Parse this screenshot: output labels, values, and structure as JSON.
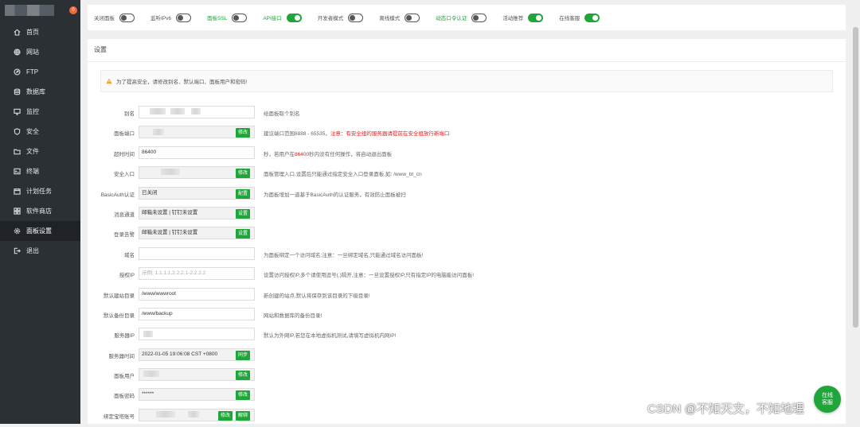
{
  "brand": {
    "badge": "0"
  },
  "sidebar": {
    "items": [
      {
        "label": "首页",
        "icon": "home-icon"
      },
      {
        "label": "网站",
        "icon": "globe-icon"
      },
      {
        "label": "FTP",
        "icon": "ftp-icon"
      },
      {
        "label": "数据库",
        "icon": "database-icon"
      },
      {
        "label": "监控",
        "icon": "monitor-icon"
      },
      {
        "label": "安全",
        "icon": "shield-icon"
      },
      {
        "label": "文件",
        "icon": "folder-icon"
      },
      {
        "label": "终端",
        "icon": "terminal-icon"
      },
      {
        "label": "计划任务",
        "icon": "calendar-icon"
      },
      {
        "label": "软件商店",
        "icon": "store-icon"
      },
      {
        "label": "面板设置",
        "icon": "gear-icon",
        "active": true
      },
      {
        "label": "退出",
        "icon": "logout-icon"
      }
    ]
  },
  "switches": [
    {
      "label": "关闭面板",
      "on": false,
      "green": false
    },
    {
      "label": "监听IPv6",
      "on": false,
      "green": false
    },
    {
      "label": "面板SSL",
      "on": false,
      "green": true
    },
    {
      "label": "API接口",
      "on": true,
      "green": true
    },
    {
      "label": "开发者模式",
      "on": false,
      "green": false
    },
    {
      "label": "离线模式",
      "on": false,
      "green": false
    },
    {
      "label": "动态口令认证",
      "on": false,
      "green": true
    },
    {
      "label": "活动推荐",
      "on": true,
      "green": false
    },
    {
      "label": "在线客服",
      "on": true,
      "green": false
    }
  ],
  "panel": {
    "title": "设置",
    "warning": "为了提高安全，请修改别名、默认端口、面板用户和密码!"
  },
  "settings": {
    "alias": {
      "label": "别名",
      "desc": "给面板取个别名"
    },
    "port": {
      "label": "面板端口",
      "button": "修改",
      "desc_prefix": "建议端口范围8888 - 65535，",
      "desc_warn": "注意：有安全组的服务器请提前在安全组放行新端口"
    },
    "timeout": {
      "label": "超时时间",
      "value": "86400",
      "desc_prefix": "秒，若用户在",
      "desc_value": "86400",
      "desc_suffix": "秒内没有任何操作，将自动退出面板"
    },
    "entry": {
      "label": "安全入口",
      "button": "修改",
      "desc": "面板管理入口,设置后只能通过指定安全入口登录面板,如: /www_bt_cn"
    },
    "basicauth": {
      "label": "BasicAuth认证",
      "value": "已关闭",
      "button": "配置",
      "desc": "为面板增加一道基于BasicAuth的认证服务，有效防止面板被扫"
    },
    "notify": {
      "label": "消息通道",
      "value": "邮箱未设置 | 钉钉未设置",
      "button": "设置"
    },
    "login_alert": {
      "label": "登录告警",
      "value": "邮箱未设置 | 钉钉未设置",
      "button": "设置"
    },
    "domain": {
      "label": "域名",
      "desc": "为面板绑定一个访问域名;注意：一旦绑定域名,只能通过域名访问面板!"
    },
    "auth_ip": {
      "label": "授权IP",
      "placeholder": "示例: 1.1.1.1,2.2.2.1-2.2.2.2",
      "desc": "设置访问授权IP,多个请使用逗号(,)隔开,注意：一旦设置授权IP,只有指定IP的电脑能访问面板!"
    },
    "site_dir": {
      "label": "默认建站目录",
      "value": "/www/wwwroot",
      "desc": "新创建的站点,默认将保存到该目录的下级目录!"
    },
    "backup_dir": {
      "label": "默认备份目录",
      "value": "/www/backup",
      "desc": "网站和数据库的备份目录!"
    },
    "server_ip": {
      "label": "服务器IP",
      "desc": "默认为外网IP,若您在本地虚拟机测试,请填写虚拟机内网IP!"
    },
    "server_time": {
      "label": "服务器时间",
      "value": "2022-01-05 19:06:08 CST +0800",
      "button": "同步"
    },
    "panel_user": {
      "label": "面板用户",
      "button": "修改"
    },
    "panel_pass": {
      "label": "面板密码",
      "value": "******",
      "button": "修改"
    },
    "bind_account": {
      "label": "绑定宝塔账号",
      "button": "修改",
      "button2": "解绑"
    }
  },
  "floating": {
    "online_line1": "在线",
    "online_line2": "客服"
  },
  "watermark": "CSDN @不知天文，不知地理"
}
